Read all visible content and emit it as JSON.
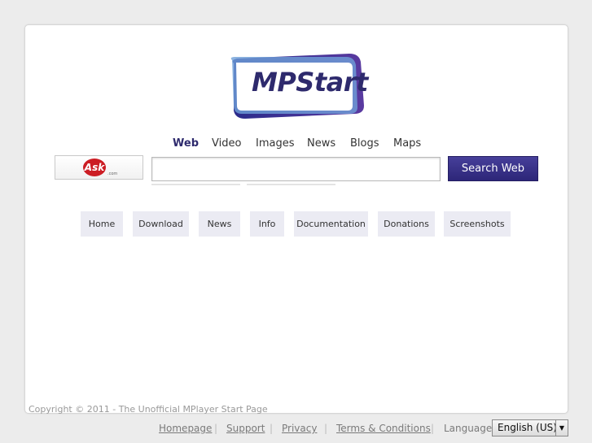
{
  "logo": {
    "text": "MPStart"
  },
  "tabs": [
    {
      "label": "Web",
      "active": true
    },
    {
      "label": "Video"
    },
    {
      "label": "Images"
    },
    {
      "label": "News"
    },
    {
      "label": "Blogs"
    },
    {
      "label": "Maps"
    }
  ],
  "search": {
    "provider_logo": "Ask",
    "provider_logo_sub": ".com",
    "value": "",
    "button_label": "Search Web"
  },
  "nav": [
    "Home",
    "Download",
    "News",
    "Info",
    "Documentation",
    "Donations",
    "Screenshots"
  ],
  "footer": {
    "copyright": "Copyright © 2011 - The Unofficial MPlayer Start Page",
    "links": [
      "Homepage",
      "Support",
      "Privacy",
      "Terms & Conditions"
    ],
    "separator": "|",
    "language_label": "Language:",
    "language_value": "English (US)"
  },
  "colors": {
    "brand": "#2e2a6d",
    "button": "#3a3389",
    "ask_red": "#cc1d24"
  }
}
